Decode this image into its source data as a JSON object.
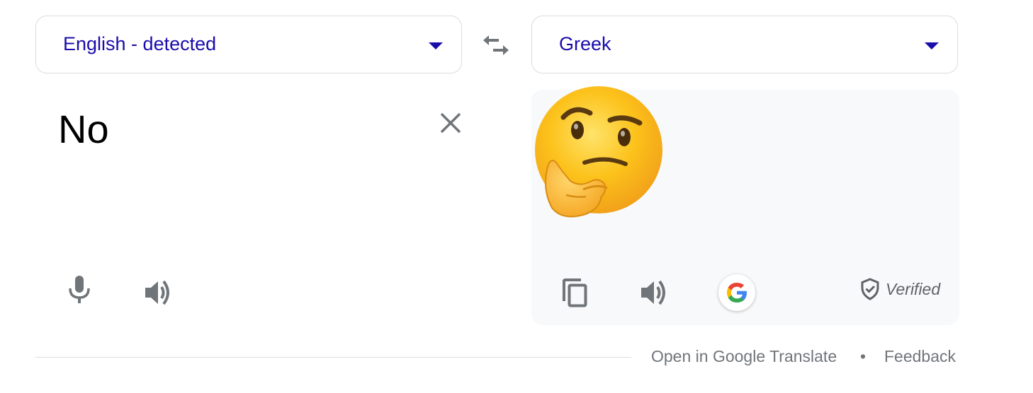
{
  "source_language": {
    "label": "English - detected"
  },
  "target_language": {
    "label": "Greek"
  },
  "source": {
    "text": "No"
  },
  "result": {
    "emoji": "thinking-face"
  },
  "verified": {
    "label": "Verified"
  },
  "footer": {
    "open_link": "Open in Google Translate",
    "separator": "•",
    "feedback_link": "Feedback"
  },
  "colors": {
    "link_blue": "#1a0dab",
    "icon_gray": "#70757a",
    "border": "#dadce0",
    "result_bg": "#f8f9fa"
  },
  "icons": [
    "dropdown-arrow-icon",
    "swap-languages-icon",
    "clear-icon",
    "microphone-icon",
    "speaker-icon",
    "copy-icon",
    "google-logo-icon",
    "shield-check-icon"
  ]
}
